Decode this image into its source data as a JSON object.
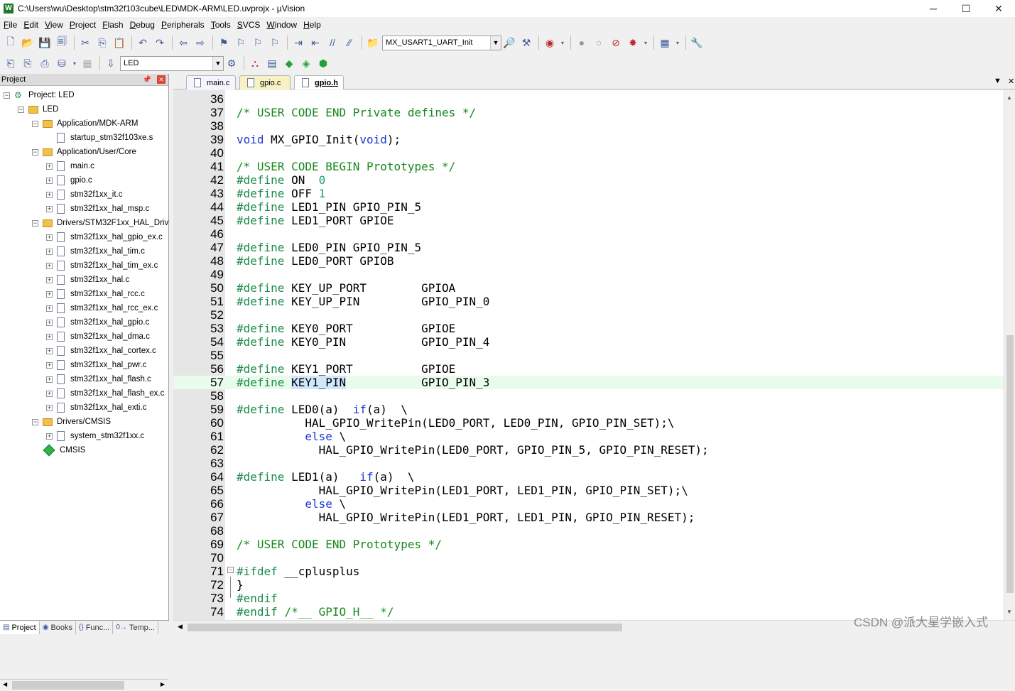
{
  "window": {
    "title": "C:\\Users\\wu\\Desktop\\stm32f103cube\\LED\\MDK-ARM\\LED.uvprojx - µVision",
    "app_icon": "W"
  },
  "menu": [
    {
      "key": "F",
      "rest": "ile"
    },
    {
      "key": "E",
      "rest": "dit"
    },
    {
      "key": "V",
      "rest": "iew"
    },
    {
      "key": "P",
      "rest": "roject"
    },
    {
      "key": "F",
      "rest": "lash"
    },
    {
      "key": "D",
      "rest": "ebug"
    },
    {
      "key": "P",
      "rest": "eripherals"
    },
    {
      "key": "T",
      "rest": "ools"
    },
    {
      "key": "S",
      "rest": "VCS"
    },
    {
      "key": "W",
      "rest": "indow"
    },
    {
      "key": "H",
      "rest": "elp"
    }
  ],
  "toolbar": {
    "function_combo": "MX_USART1_UART_Init",
    "target_combo": "LED"
  },
  "project_panel": {
    "title": "Project",
    "items": [
      {
        "label": "Project: LED",
        "level": 0,
        "type": "project",
        "exp": "−"
      },
      {
        "label": "LED",
        "level": 1,
        "type": "folder",
        "exp": "−"
      },
      {
        "label": "Application/MDK-ARM",
        "level": 2,
        "type": "folder",
        "exp": "−"
      },
      {
        "label": "startup_stm32f103xe.s",
        "level": 3,
        "type": "file",
        "exp": ""
      },
      {
        "label": "Application/User/Core",
        "level": 2,
        "type": "folder",
        "exp": "−"
      },
      {
        "label": "main.c",
        "level": 3,
        "type": "file",
        "exp": "+"
      },
      {
        "label": "gpio.c",
        "level": 3,
        "type": "file",
        "exp": "+"
      },
      {
        "label": "stm32f1xx_it.c",
        "level": 3,
        "type": "file",
        "exp": "+"
      },
      {
        "label": "stm32f1xx_hal_msp.c",
        "level": 3,
        "type": "file",
        "exp": "+"
      },
      {
        "label": "Drivers/STM32F1xx_HAL_Driv",
        "level": 2,
        "type": "folder",
        "exp": "−"
      },
      {
        "label": "stm32f1xx_hal_gpio_ex.c",
        "level": 3,
        "type": "file",
        "exp": "+"
      },
      {
        "label": "stm32f1xx_hal_tim.c",
        "level": 3,
        "type": "file",
        "exp": "+"
      },
      {
        "label": "stm32f1xx_hal_tim_ex.c",
        "level": 3,
        "type": "file",
        "exp": "+"
      },
      {
        "label": "stm32f1xx_hal.c",
        "level": 3,
        "type": "file",
        "exp": "+"
      },
      {
        "label": "stm32f1xx_hal_rcc.c",
        "level": 3,
        "type": "file",
        "exp": "+"
      },
      {
        "label": "stm32f1xx_hal_rcc_ex.c",
        "level": 3,
        "type": "file",
        "exp": "+"
      },
      {
        "label": "stm32f1xx_hal_gpio.c",
        "level": 3,
        "type": "file",
        "exp": "+"
      },
      {
        "label": "stm32f1xx_hal_dma.c",
        "level": 3,
        "type": "file",
        "exp": "+"
      },
      {
        "label": "stm32f1xx_hal_cortex.c",
        "level": 3,
        "type": "file",
        "exp": "+"
      },
      {
        "label": "stm32f1xx_hal_pwr.c",
        "level": 3,
        "type": "file",
        "exp": "+"
      },
      {
        "label": "stm32f1xx_hal_flash.c",
        "level": 3,
        "type": "file",
        "exp": "+"
      },
      {
        "label": "stm32f1xx_hal_flash_ex.c",
        "level": 3,
        "type": "file",
        "exp": "+"
      },
      {
        "label": "stm32f1xx_hal_exti.c",
        "level": 3,
        "type": "file",
        "exp": "+"
      },
      {
        "label": "Drivers/CMSIS",
        "level": 2,
        "type": "folder",
        "exp": "−"
      },
      {
        "label": "system_stm32f1xx.c",
        "level": 3,
        "type": "file",
        "exp": "+"
      },
      {
        "label": "CMSIS",
        "level": 2,
        "type": "gem",
        "exp": ""
      }
    ]
  },
  "bottom_tabs": [
    {
      "label": "Project",
      "icon": "▤",
      "active": true
    },
    {
      "label": "Books",
      "icon": "◉",
      "active": false
    },
    {
      "label": "Func...",
      "icon": "{}",
      "active": false
    },
    {
      "label": "Temp...",
      "icon": "0→",
      "active": false
    }
  ],
  "editor_tabs": [
    {
      "label": "main.c",
      "cls": "main"
    },
    {
      "label": "gpio.c",
      "cls": "gpioc"
    },
    {
      "label": "gpio.h",
      "cls": "gpioh"
    }
  ],
  "code": {
    "first_line": 36,
    "highlight_line": 57,
    "lines": [
      [],
      [
        [
          "cm",
          "/* USER CODE END Private defines */"
        ]
      ],
      [],
      [
        [
          "kw",
          "void"
        ],
        [
          "t",
          " MX_GPIO_Init("
        ],
        [
          "kw",
          "void"
        ],
        [
          "t",
          ");"
        ]
      ],
      [],
      [
        [
          "cm",
          "/* USER CODE BEGIN Prototypes */"
        ]
      ],
      [
        [
          "pp",
          "#define"
        ],
        [
          "t",
          " ON  "
        ],
        [
          "num",
          "0"
        ]
      ],
      [
        [
          "pp",
          "#define"
        ],
        [
          "t",
          " OFF "
        ],
        [
          "num",
          "1"
        ]
      ],
      [
        [
          "pp",
          "#define"
        ],
        [
          "t",
          " LED1_PIN GPIO_PIN_5"
        ]
      ],
      [
        [
          "pp",
          "#define"
        ],
        [
          "t",
          " LED1_PORT GPIOE"
        ]
      ],
      [],
      [
        [
          "pp",
          "#define"
        ],
        [
          "t",
          " LED0_PIN GPIO_PIN_5"
        ]
      ],
      [
        [
          "pp",
          "#define"
        ],
        [
          "t",
          " LED0_PORT GPIOB"
        ]
      ],
      [],
      [
        [
          "pp",
          "#define"
        ],
        [
          "t",
          " KEY_UP_PORT        GPIOA"
        ]
      ],
      [
        [
          "pp",
          "#define"
        ],
        [
          "t",
          " KEY_UP_PIN         GPIO_PIN_0"
        ]
      ],
      [],
      [
        [
          "pp",
          "#define"
        ],
        [
          "t",
          " KEY0_PORT          GPIOE"
        ]
      ],
      [
        [
          "pp",
          "#define"
        ],
        [
          "t",
          " KEY0_PIN           GPIO_PIN_4"
        ]
      ],
      [],
      [
        [
          "pp",
          "#define"
        ],
        [
          "t",
          " KEY1_PORT          GPIOE"
        ]
      ],
      [
        [
          "pp",
          "#define"
        ],
        [
          "t",
          " "
        ],
        [
          "sel",
          "KEY1_PIN"
        ],
        [
          "t",
          "           GPIO_PIN_3"
        ]
      ],
      [],
      [
        [
          "pp",
          "#define"
        ],
        [
          "t",
          " LED0(a)  "
        ],
        [
          "kw",
          "if"
        ],
        [
          "t",
          "(a)  \\"
        ]
      ],
      [
        [
          "t",
          "          HAL_GPIO_WritePin(LED0_PORT, LED0_PIN, GPIO_PIN_SET);\\"
        ]
      ],
      [
        [
          "t",
          "          "
        ],
        [
          "kw",
          "else"
        ],
        [
          "t",
          " \\"
        ]
      ],
      [
        [
          "t",
          "            HAL_GPIO_WritePin(LED0_PORT, GPIO_PIN_5, GPIO_PIN_RESET);"
        ]
      ],
      [],
      [
        [
          "pp",
          "#define"
        ],
        [
          "t",
          " LED1(a)   "
        ],
        [
          "kw",
          "if"
        ],
        [
          "t",
          "(a)  \\"
        ]
      ],
      [
        [
          "t",
          "            HAL_GPIO_WritePin(LED1_PORT, LED1_PIN, GPIO_PIN_SET);\\"
        ]
      ],
      [
        [
          "t",
          "          "
        ],
        [
          "kw",
          "else"
        ],
        [
          "t",
          " \\"
        ]
      ],
      [
        [
          "t",
          "            HAL_GPIO_WritePin(LED1_PORT, LED1_PIN, GPIO_PIN_RESET);"
        ]
      ],
      [],
      [
        [
          "cm",
          "/* USER CODE END Prototypes */"
        ]
      ],
      [],
      [
        [
          "pp",
          "#ifdef"
        ],
        [
          "t",
          " __cplusplus"
        ]
      ],
      [
        [
          "t",
          "}"
        ]
      ],
      [
        [
          "pp",
          "#endif"
        ]
      ],
      [
        [
          "pp",
          "#endif"
        ],
        [
          "t",
          " "
        ],
        [
          "cm",
          "/*__ GPIO_H__ */"
        ]
      ]
    ]
  },
  "watermark": "CSDN @派大星学嵌入式"
}
